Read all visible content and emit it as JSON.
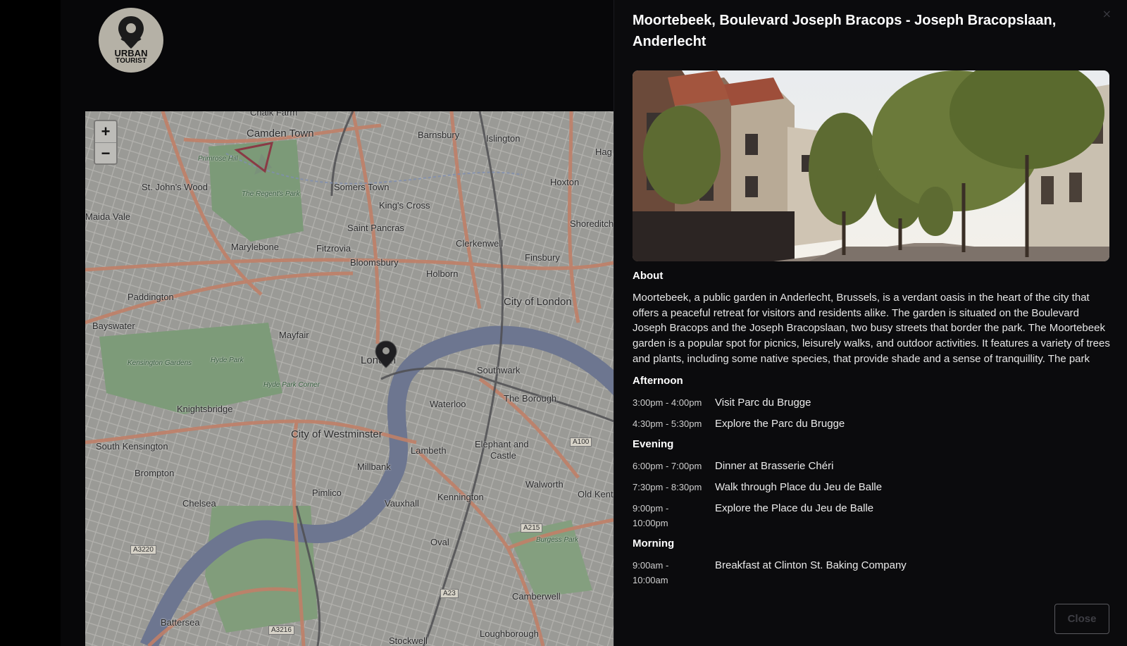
{
  "logo": {
    "line1": "URBAN",
    "line2": "TOURIST"
  },
  "map": {
    "zoom_in": "+",
    "zoom_out": "−",
    "labels": [
      {
        "text": "Camden Town"
      },
      {
        "text": "Barnsbury"
      },
      {
        "text": "Islington"
      },
      {
        "text": "Hoxton"
      },
      {
        "text": "St. John's Wood"
      },
      {
        "text": "Somers Town"
      },
      {
        "text": "King's Cross"
      },
      {
        "text": "Saint Pancras"
      },
      {
        "text": "Marylebone"
      },
      {
        "text": "Fitzrovia"
      },
      {
        "text": "Clerkenwell"
      },
      {
        "text": "Finsbury"
      },
      {
        "text": "Bloomsbury"
      },
      {
        "text": "Holborn"
      },
      {
        "text": "Paddington"
      },
      {
        "text": "City of London"
      },
      {
        "text": "Bayswater"
      },
      {
        "text": "Mayfair"
      },
      {
        "text": "London"
      },
      {
        "text": "Southwark"
      },
      {
        "text": "The Borough"
      },
      {
        "text": "Waterloo"
      },
      {
        "text": "Knightsbridge"
      },
      {
        "text": "City of Westminster"
      },
      {
        "text": "Elephant and"
      },
      {
        "text": "Castle"
      },
      {
        "text": "South Kensington"
      },
      {
        "text": "Lambeth"
      },
      {
        "text": "Millbank"
      },
      {
        "text": "Brompton"
      },
      {
        "text": "Pimlico"
      },
      {
        "text": "Walworth"
      },
      {
        "text": "Chelsea"
      },
      {
        "text": "Vauxhall"
      },
      {
        "text": "Kennington"
      },
      {
        "text": "Oval"
      },
      {
        "text": "Camberwell"
      },
      {
        "text": "Battersea"
      },
      {
        "text": "Stockwell"
      },
      {
        "text": "Loughborough"
      },
      {
        "text": "Shoreditch"
      },
      {
        "text": "Maida Vale"
      },
      {
        "text": "Old Kent"
      },
      {
        "text": "Hag"
      },
      {
        "text": "Chalk Farm"
      }
    ],
    "park_labels": [
      {
        "text": "Primrose Hill"
      },
      {
        "text": "The Regent's Park"
      },
      {
        "text": "Kensington Gardens"
      },
      {
        "text": "Hyde Park"
      },
      {
        "text": "Hyde Park Corner"
      },
      {
        "text": "Burgess Park"
      }
    ],
    "road_badges": [
      {
        "text": "A100"
      },
      {
        "text": "A215"
      },
      {
        "text": "A3220"
      },
      {
        "text": "A23"
      },
      {
        "text": "A3216"
      }
    ]
  },
  "panel": {
    "close_icon": "×",
    "title": "Moortebeek, Boulevard Joseph Bracops - Joseph Bracopslaan, Anderlecht",
    "about_heading": "About",
    "about_text": "Moortebeek, a public garden in Anderlecht, Brussels, is a verdant oasis in the heart of the city that offers a peaceful retreat for visitors and residents alike. The garden is situated on the Boulevard Joseph Bracops and the Joseph Bracopslaan, two busy streets that border the park. The Moortebeek garden is a popular spot for picnics, leisurely walks, and outdoor activities. It features a variety of trees and plants, including some native species, that provide shade and a sense of tranquillity. The park",
    "sections": [
      {
        "heading": "Afternoon",
        "items": [
          {
            "time": "3:00pm - 4:00pm",
            "activity": "Visit Parc du Brugge"
          },
          {
            "time": "4:30pm - 5:30pm",
            "activity": "Explore the Parc du Brugge"
          }
        ]
      },
      {
        "heading": "Evening",
        "items": [
          {
            "time": "6:00pm - 7:00pm",
            "activity": "Dinner at Brasserie Chéri"
          },
          {
            "time": "7:30pm - 8:30pm",
            "activity": "Walk through Place du Jeu de Balle"
          },
          {
            "time": "9:00pm - 10:00pm",
            "activity": "Explore the Place du Jeu de Balle"
          }
        ]
      },
      {
        "heading": "Morning",
        "items": [
          {
            "time": "9:00am - 10:00am",
            "activity": "Breakfast at Clinton St. Baking Company"
          }
        ]
      }
    ],
    "close_button": "Close"
  }
}
